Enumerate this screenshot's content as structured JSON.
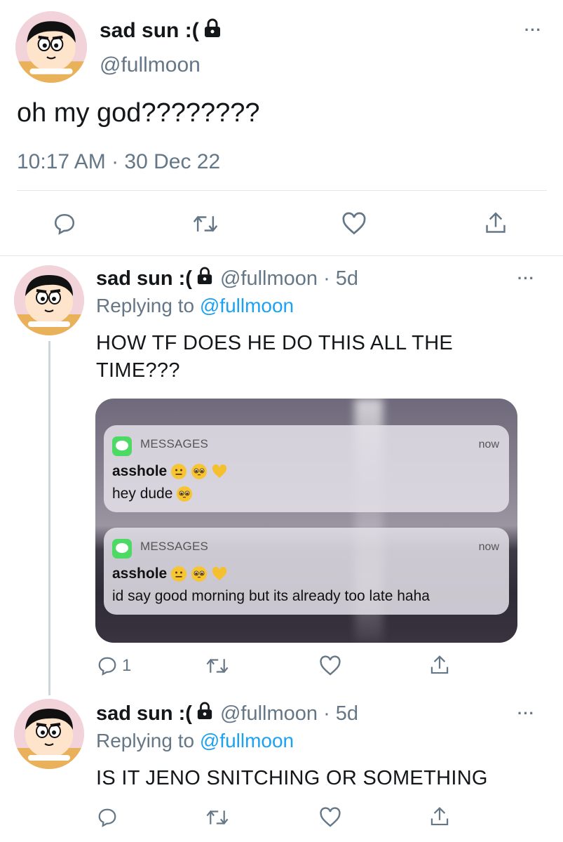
{
  "main_tweet": {
    "author_name": "sad sun :(",
    "handle": "@fullmoon",
    "text": "oh my god????????",
    "timestamp": "10:17 AM · 30 Dec 22"
  },
  "reply1": {
    "author_name": "sad sun :(",
    "handle_meta": "@fullmoon · 5d",
    "replying_prefix": "Replying to ",
    "replying_handle": "@fullmoon",
    "text": "HOW TF DOES HE DO THIS ALL THE TIME???",
    "reply_count": "1",
    "notifications": [
      {
        "app": "MESSAGES",
        "time": "now",
        "sender": "asshole",
        "message": "hey dude"
      },
      {
        "app": "MESSAGES",
        "time": "now",
        "sender": "asshole",
        "message": "id say good morning but its already too late haha"
      }
    ]
  },
  "reply2": {
    "author_name": "sad sun :(",
    "handle_meta": "@fullmoon · 5d",
    "replying_prefix": "Replying to ",
    "replying_handle": "@fullmoon",
    "text": "IS IT JENO SNITCHING OR SOMETHING"
  },
  "icons": {
    "more": "more-icon",
    "lock": "lock-icon",
    "reply": "reply-icon",
    "retweet": "retweet-icon",
    "like": "like-icon",
    "share": "share-icon"
  },
  "colors": {
    "link": "#1da1f2",
    "secondary_text": "#657786",
    "divider": "#e1e8ed",
    "imessage_green": "#4cd964"
  }
}
